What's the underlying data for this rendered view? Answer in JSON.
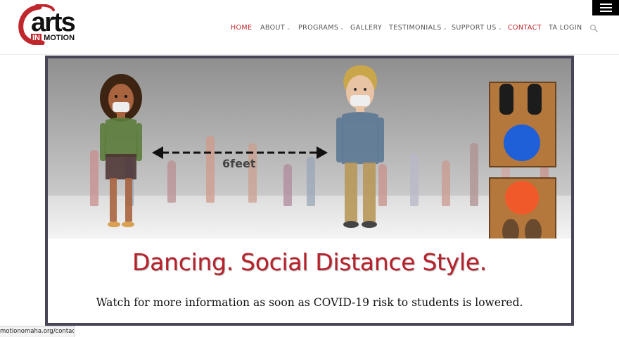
{
  "logo": {
    "word": "arts",
    "sub_in": "IN",
    "sub_motion": "MOTION"
  },
  "nav": {
    "items": [
      {
        "label": "HOME",
        "dropdown": false,
        "active": true
      },
      {
        "label": "ABOUT",
        "dropdown": true,
        "active": false
      },
      {
        "label": "PROGRAMS",
        "dropdown": true,
        "active": false
      },
      {
        "label": "GALLERY",
        "dropdown": false,
        "active": false
      },
      {
        "label": "TESTIMONIALS",
        "dropdown": true,
        "active": false
      },
      {
        "label": "SUPPORT US",
        "dropdown": true,
        "active": false
      },
      {
        "label": "CONTACT",
        "dropdown": false,
        "active": true
      },
      {
        "label": "TA LOGIN",
        "dropdown": false,
        "active": false
      }
    ],
    "chevron": "⌄"
  },
  "banner": {
    "distance_label": "6feet",
    "title": "Dancing. Social Distance Style.",
    "subtitle": "Watch for more information as soon as COVID-19 risk to students is lowered."
  },
  "status_bar": {
    "url": "motionomaha.org/contact/"
  },
  "colors": {
    "brand_red": "#c0272d",
    "title_red": "#b8202a",
    "frame": "#4a4458"
  }
}
